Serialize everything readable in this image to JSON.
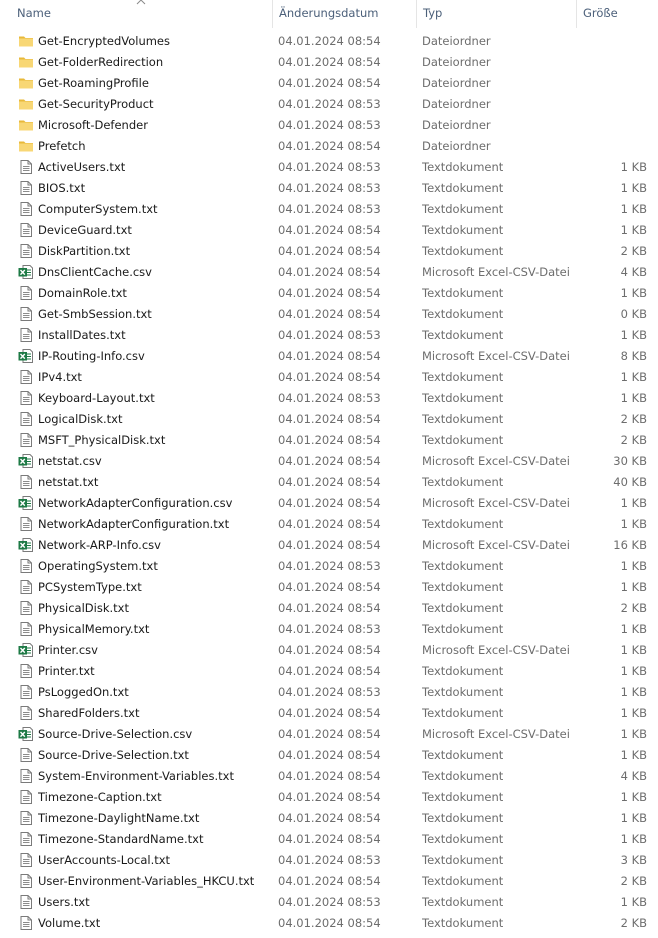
{
  "columns": {
    "name": "Name",
    "date": "Änderungsdatum",
    "type": "Typ",
    "size": "Größe"
  },
  "sort": {
    "column": "name",
    "direction": "ascending"
  },
  "colors": {
    "folder": "#f8d775",
    "folder_dark": "#e8b93a",
    "excel_green": "#1d7a45",
    "header_text": "#4c607a",
    "detail_text": "#6d6d6d"
  },
  "files": [
    {
      "name": "Get-EncryptedVolumes",
      "date": "04.01.2024 08:54",
      "type": "Dateiordner",
      "size": "",
      "icon": "folder-icon"
    },
    {
      "name": "Get-FolderRedirection",
      "date": "04.01.2024 08:54",
      "type": "Dateiordner",
      "size": "",
      "icon": "folder-icon"
    },
    {
      "name": "Get-RoamingProfile",
      "date": "04.01.2024 08:54",
      "type": "Dateiordner",
      "size": "",
      "icon": "folder-icon"
    },
    {
      "name": "Get-SecurityProduct",
      "date": "04.01.2024 08:53",
      "type": "Dateiordner",
      "size": "",
      "icon": "folder-icon"
    },
    {
      "name": "Microsoft-Defender",
      "date": "04.01.2024 08:53",
      "type": "Dateiordner",
      "size": "",
      "icon": "folder-icon"
    },
    {
      "name": "Prefetch",
      "date": "04.01.2024 08:54",
      "type": "Dateiordner",
      "size": "",
      "icon": "folder-icon"
    },
    {
      "name": "ActiveUsers.txt",
      "date": "04.01.2024 08:53",
      "type": "Textdokument",
      "size": "1 KB",
      "icon": "text-file-icon"
    },
    {
      "name": "BIOS.txt",
      "date": "04.01.2024 08:53",
      "type": "Textdokument",
      "size": "1 KB",
      "icon": "text-file-icon"
    },
    {
      "name": "ComputerSystem.txt",
      "date": "04.01.2024 08:53",
      "type": "Textdokument",
      "size": "1 KB",
      "icon": "text-file-icon"
    },
    {
      "name": "DeviceGuard.txt",
      "date": "04.01.2024 08:54",
      "type": "Textdokument",
      "size": "1 KB",
      "icon": "text-file-icon"
    },
    {
      "name": "DiskPartition.txt",
      "date": "04.01.2024 08:54",
      "type": "Textdokument",
      "size": "2 KB",
      "icon": "text-file-icon"
    },
    {
      "name": "DnsClientCache.csv",
      "date": "04.01.2024 08:54",
      "type": "Microsoft Excel-CSV-Datei",
      "size": "4 KB",
      "icon": "excel-csv-icon"
    },
    {
      "name": "DomainRole.txt",
      "date": "04.01.2024 08:54",
      "type": "Textdokument",
      "size": "1 KB",
      "icon": "text-file-icon"
    },
    {
      "name": "Get-SmbSession.txt",
      "date": "04.01.2024 08:54",
      "type": "Textdokument",
      "size": "0 KB",
      "icon": "text-file-icon"
    },
    {
      "name": "InstallDates.txt",
      "date": "04.01.2024 08:53",
      "type": "Textdokument",
      "size": "1 KB",
      "icon": "text-file-icon"
    },
    {
      "name": "IP-Routing-Info.csv",
      "date": "04.01.2024 08:54",
      "type": "Microsoft Excel-CSV-Datei",
      "size": "8 KB",
      "icon": "excel-csv-icon"
    },
    {
      "name": "IPv4.txt",
      "date": "04.01.2024 08:54",
      "type": "Textdokument",
      "size": "1 KB",
      "icon": "text-file-icon"
    },
    {
      "name": "Keyboard-Layout.txt",
      "date": "04.01.2024 08:53",
      "type": "Textdokument",
      "size": "1 KB",
      "icon": "text-file-icon"
    },
    {
      "name": "LogicalDisk.txt",
      "date": "04.01.2024 08:54",
      "type": "Textdokument",
      "size": "2 KB",
      "icon": "text-file-icon"
    },
    {
      "name": "MSFT_PhysicalDisk.txt",
      "date": "04.01.2024 08:54",
      "type": "Textdokument",
      "size": "2 KB",
      "icon": "text-file-icon"
    },
    {
      "name": "netstat.csv",
      "date": "04.01.2024 08:54",
      "type": "Microsoft Excel-CSV-Datei",
      "size": "30 KB",
      "icon": "excel-csv-icon"
    },
    {
      "name": "netstat.txt",
      "date": "04.01.2024 08:54",
      "type": "Textdokument",
      "size": "40 KB",
      "icon": "text-file-icon"
    },
    {
      "name": "NetworkAdapterConfiguration.csv",
      "date": "04.01.2024 08:54",
      "type": "Microsoft Excel-CSV-Datei",
      "size": "1 KB",
      "icon": "excel-csv-icon"
    },
    {
      "name": "NetworkAdapterConfiguration.txt",
      "date": "04.01.2024 08:54",
      "type": "Textdokument",
      "size": "1 KB",
      "icon": "text-file-icon"
    },
    {
      "name": "Network-ARP-Info.csv",
      "date": "04.01.2024 08:54",
      "type": "Microsoft Excel-CSV-Datei",
      "size": "16 KB",
      "icon": "excel-csv-icon"
    },
    {
      "name": "OperatingSystem.txt",
      "date": "04.01.2024 08:53",
      "type": "Textdokument",
      "size": "1 KB",
      "icon": "text-file-icon"
    },
    {
      "name": "PCSystemType.txt",
      "date": "04.01.2024 08:54",
      "type": "Textdokument",
      "size": "1 KB",
      "icon": "text-file-icon"
    },
    {
      "name": "PhysicalDisk.txt",
      "date": "04.01.2024 08:54",
      "type": "Textdokument",
      "size": "2 KB",
      "icon": "text-file-icon"
    },
    {
      "name": "PhysicalMemory.txt",
      "date": "04.01.2024 08:53",
      "type": "Textdokument",
      "size": "1 KB",
      "icon": "text-file-icon"
    },
    {
      "name": "Printer.csv",
      "date": "04.01.2024 08:54",
      "type": "Microsoft Excel-CSV-Datei",
      "size": "1 KB",
      "icon": "excel-csv-icon"
    },
    {
      "name": "Printer.txt",
      "date": "04.01.2024 08:54",
      "type": "Textdokument",
      "size": "1 KB",
      "icon": "text-file-icon"
    },
    {
      "name": "PsLoggedOn.txt",
      "date": "04.01.2024 08:53",
      "type": "Textdokument",
      "size": "1 KB",
      "icon": "text-file-icon"
    },
    {
      "name": "SharedFolders.txt",
      "date": "04.01.2024 08:54",
      "type": "Textdokument",
      "size": "1 KB",
      "icon": "text-file-icon"
    },
    {
      "name": "Source-Drive-Selection.csv",
      "date": "04.01.2024 08:54",
      "type": "Microsoft Excel-CSV-Datei",
      "size": "1 KB",
      "icon": "excel-csv-icon"
    },
    {
      "name": "Source-Drive-Selection.txt",
      "date": "04.01.2024 08:54",
      "type": "Textdokument",
      "size": "1 KB",
      "icon": "text-file-icon"
    },
    {
      "name": "System-Environment-Variables.txt",
      "date": "04.01.2024 08:54",
      "type": "Textdokument",
      "size": "4 KB",
      "icon": "text-file-icon"
    },
    {
      "name": "Timezone-Caption.txt",
      "date": "04.01.2024 08:54",
      "type": "Textdokument",
      "size": "1 KB",
      "icon": "text-file-icon"
    },
    {
      "name": "Timezone-DaylightName.txt",
      "date": "04.01.2024 08:54",
      "type": "Textdokument",
      "size": "1 KB",
      "icon": "text-file-icon"
    },
    {
      "name": "Timezone-StandardName.txt",
      "date": "04.01.2024 08:54",
      "type": "Textdokument",
      "size": "1 KB",
      "icon": "text-file-icon"
    },
    {
      "name": "UserAccounts-Local.txt",
      "date": "04.01.2024 08:53",
      "type": "Textdokument",
      "size": "3 KB",
      "icon": "text-file-icon"
    },
    {
      "name": "User-Environment-Variables_HKCU.txt",
      "date": "04.01.2024 08:54",
      "type": "Textdokument",
      "size": "2 KB",
      "icon": "text-file-icon"
    },
    {
      "name": "Users.txt",
      "date": "04.01.2024 08:53",
      "type": "Textdokument",
      "size": "1 KB",
      "icon": "text-file-icon"
    },
    {
      "name": "Volume.txt",
      "date": "04.01.2024 08:54",
      "type": "Textdokument",
      "size": "2 KB",
      "icon": "text-file-icon"
    }
  ]
}
